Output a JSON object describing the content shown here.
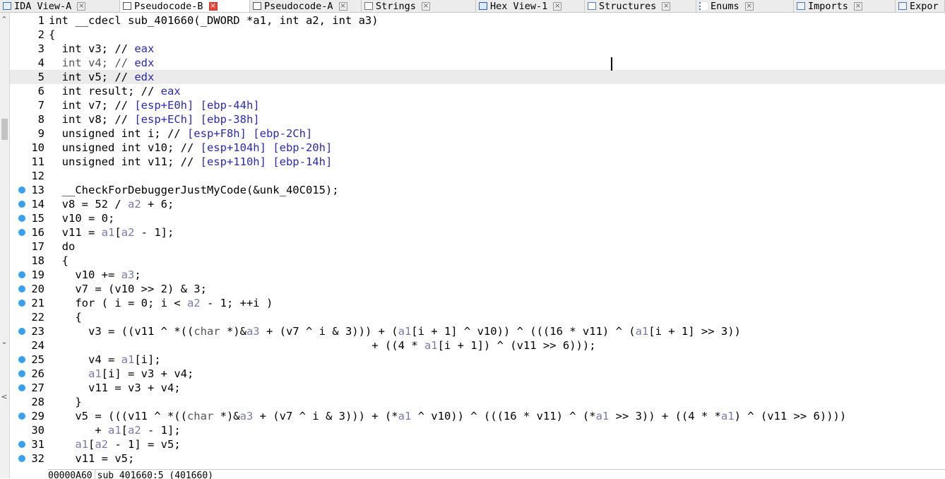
{
  "tabs": [
    {
      "label": "IDA View-A",
      "icon": "graph-icon",
      "active": false
    },
    {
      "label": "Pseudocode-B",
      "icon": "document-icon",
      "active": true
    },
    {
      "label": "Pseudocode-A",
      "icon": "document-icon",
      "active": false
    },
    {
      "label": "Strings",
      "icon": "strings-icon",
      "active": false
    },
    {
      "label": "Hex View-1",
      "icon": "hex-icon",
      "active": false
    },
    {
      "label": "Structures",
      "icon": "structures-icon",
      "active": false
    },
    {
      "label": "Enums",
      "icon": "enums-icon",
      "active": false
    },
    {
      "label": "Imports",
      "icon": "imports-icon",
      "active": false
    },
    {
      "label": "Expor",
      "icon": "exports-icon",
      "active": false
    }
  ],
  "close_glyph": "×",
  "scroll": {
    "up": "⌃",
    "down": "⌄",
    "left": "<"
  },
  "status": {
    "address": "00000A60",
    "location": "sub_401660:5 (401660)"
  },
  "colors": {
    "breakpoint": "#39a0ef",
    "active_close": "#e8463c",
    "line_highlight": "#ebebeb"
  },
  "lines": [
    {
      "no": "1",
      "bp": false,
      "segs": [
        {
          "t": "int __cdecl sub_401660(_DWORD *a1, int a2, int a3)",
          "c": "n"
        }
      ]
    },
    {
      "no": "2",
      "bp": false,
      "segs": [
        {
          "t": "{",
          "c": "n"
        }
      ]
    },
    {
      "no": "3",
      "bp": false,
      "segs": [
        {
          "t": "  int v3; // ",
          "c": "n"
        },
        {
          "t": "eax",
          "c": "lv"
        }
      ]
    },
    {
      "no": "4",
      "bp": false,
      "segs": [
        {
          "t": "  int v4; // ",
          "c": "g"
        },
        {
          "t": "edx",
          "c": "lv"
        }
      ]
    },
    {
      "no": "5",
      "bp": false,
      "hl": true,
      "segs": [
        {
          "t": "  int v5; // ",
          "c": "n"
        },
        {
          "t": "edx",
          "c": "lv"
        }
      ]
    },
    {
      "no": "6",
      "bp": false,
      "segs": [
        {
          "t": "  int result; // ",
          "c": "n"
        },
        {
          "t": "eax",
          "c": "lv"
        }
      ]
    },
    {
      "no": "7",
      "bp": false,
      "segs": [
        {
          "t": "  int v7; // ",
          "c": "n"
        },
        {
          "t": "[esp+E0h] [ebp-44h]",
          "c": "lv"
        }
      ]
    },
    {
      "no": "8",
      "bp": false,
      "segs": [
        {
          "t": "  int v8; // ",
          "c": "n"
        },
        {
          "t": "[esp+ECh] [ebp-38h]",
          "c": "lv"
        }
      ]
    },
    {
      "no": "9",
      "bp": false,
      "segs": [
        {
          "t": "  unsigned int i; // ",
          "c": "n"
        },
        {
          "t": "[esp+F8h] [ebp-2Ch]",
          "c": "lv"
        }
      ]
    },
    {
      "no": "10",
      "bp": false,
      "segs": [
        {
          "t": "  unsigned int v10; // ",
          "c": "n"
        },
        {
          "t": "[esp+104h] [ebp-20h]",
          "c": "lv"
        }
      ]
    },
    {
      "no": "11",
      "bp": false,
      "segs": [
        {
          "t": "  unsigned int v11; // ",
          "c": "n"
        },
        {
          "t": "[esp+110h] [ebp-14h]",
          "c": "lv"
        }
      ]
    },
    {
      "no": "12",
      "bp": false,
      "segs": [
        {
          "t": "",
          "c": "n"
        }
      ]
    },
    {
      "no": "13",
      "bp": true,
      "segs": [
        {
          "t": "  __CheckForDebuggerJustMyCode(&unk_40C015);",
          "c": "n"
        }
      ]
    },
    {
      "no": "14",
      "bp": true,
      "segs": [
        {
          "t": "  v8 = 52 / ",
          "c": "n"
        },
        {
          "t": "a2",
          "c": "p"
        },
        {
          "t": " + 6;",
          "c": "n"
        }
      ]
    },
    {
      "no": "15",
      "bp": true,
      "segs": [
        {
          "t": "  v10 = 0;",
          "c": "n"
        }
      ]
    },
    {
      "no": "16",
      "bp": true,
      "segs": [
        {
          "t": "  v11 = ",
          "c": "n"
        },
        {
          "t": "a1",
          "c": "p"
        },
        {
          "t": "[",
          "c": "n"
        },
        {
          "t": "a2",
          "c": "p"
        },
        {
          "t": " - 1];",
          "c": "n"
        }
      ]
    },
    {
      "no": "17",
      "bp": false,
      "segs": [
        {
          "t": "  do",
          "c": "n"
        }
      ]
    },
    {
      "no": "18",
      "bp": false,
      "segs": [
        {
          "t": "  {",
          "c": "n"
        }
      ]
    },
    {
      "no": "19",
      "bp": true,
      "segs": [
        {
          "t": "    v10 += ",
          "c": "n"
        },
        {
          "t": "a3",
          "c": "p"
        },
        {
          "t": ";",
          "c": "n"
        }
      ]
    },
    {
      "no": "20",
      "bp": true,
      "segs": [
        {
          "t": "    v7 = (v10 >> 2) & 3;",
          "c": "n"
        }
      ]
    },
    {
      "no": "21",
      "bp": true,
      "segs": [
        {
          "t": "    for ( i = 0; i < ",
          "c": "n"
        },
        {
          "t": "a2",
          "c": "p"
        },
        {
          "t": " - 1; ++i )",
          "c": "n"
        }
      ]
    },
    {
      "no": "22",
      "bp": false,
      "segs": [
        {
          "t": "    {",
          "c": "n"
        }
      ]
    },
    {
      "no": "23",
      "bp": true,
      "segs": [
        {
          "t": "      v3 = ((v11 ^ *((",
          "c": "n"
        },
        {
          "t": "char",
          "c": "g"
        },
        {
          "t": " *)&",
          "c": "n"
        },
        {
          "t": "a3",
          "c": "p"
        },
        {
          "t": " + (v7 ^ i & 3))) + (",
          "c": "n"
        },
        {
          "t": "a1",
          "c": "p"
        },
        {
          "t": "[i + 1] ^ v10)) ^ (((16 * v11) ^ (",
          "c": "n"
        },
        {
          "t": "a1",
          "c": "p"
        },
        {
          "t": "[i + 1] >> 3))",
          "c": "n"
        }
      ]
    },
    {
      "no": "24",
      "bp": false,
      "segs": [
        {
          "t": "                                                 + ((4 * ",
          "c": "n"
        },
        {
          "t": "a1",
          "c": "p"
        },
        {
          "t": "[i + 1]) ^ (v11 >> 6)));",
          "c": "n"
        }
      ]
    },
    {
      "no": "25",
      "bp": true,
      "segs": [
        {
          "t": "      v4 = ",
          "c": "n"
        },
        {
          "t": "a1",
          "c": "p"
        },
        {
          "t": "[i];",
          "c": "n"
        }
      ]
    },
    {
      "no": "26",
      "bp": true,
      "segs": [
        {
          "t": "      ",
          "c": "n"
        },
        {
          "t": "a1",
          "c": "p"
        },
        {
          "t": "[i] = v3 + v4;",
          "c": "n"
        }
      ]
    },
    {
      "no": "27",
      "bp": true,
      "segs": [
        {
          "t": "      v11 = v3 + v4;",
          "c": "n"
        }
      ]
    },
    {
      "no": "28",
      "bp": false,
      "segs": [
        {
          "t": "    }",
          "c": "n"
        }
      ]
    },
    {
      "no": "29",
      "bp": true,
      "segs": [
        {
          "t": "    v5 = (((v11 ^ *((",
          "c": "n"
        },
        {
          "t": "char",
          "c": "g"
        },
        {
          "t": " *)&",
          "c": "n"
        },
        {
          "t": "a3",
          "c": "p"
        },
        {
          "t": " + (v7 ^ i & 3))) + (*",
          "c": "n"
        },
        {
          "t": "a1",
          "c": "p"
        },
        {
          "t": " ^ v10)) ^ (((16 * v11) ^ (*",
          "c": "n"
        },
        {
          "t": "a1",
          "c": "p"
        },
        {
          "t": " >> 3)) + ((4 * *",
          "c": "n"
        },
        {
          "t": "a1",
          "c": "p"
        },
        {
          "t": ") ^ (v11 >> 6))))",
          "c": "n"
        }
      ]
    },
    {
      "no": "30",
      "bp": false,
      "segs": [
        {
          "t": "       + ",
          "c": "n"
        },
        {
          "t": "a1",
          "c": "p"
        },
        {
          "t": "[",
          "c": "n"
        },
        {
          "t": "a2",
          "c": "p"
        },
        {
          "t": " - 1];",
          "c": "n"
        }
      ]
    },
    {
      "no": "31",
      "bp": true,
      "segs": [
        {
          "t": "    ",
          "c": "n"
        },
        {
          "t": "a1",
          "c": "p"
        },
        {
          "t": "[",
          "c": "n"
        },
        {
          "t": "a2",
          "c": "p"
        },
        {
          "t": " - 1] = v5;",
          "c": "n"
        }
      ]
    },
    {
      "no": "32",
      "bp": true,
      "segs": [
        {
          "t": "    v11 = v5;",
          "c": "n"
        }
      ]
    }
  ]
}
